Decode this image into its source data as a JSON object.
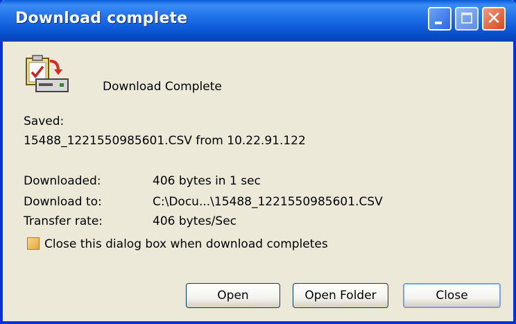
{
  "window": {
    "title": "Download complete"
  },
  "titlebar_buttons": {
    "minimize": "minimize-icon",
    "maximize": "maximize-icon",
    "close": "close-icon",
    "close_glyph": "✕"
  },
  "header": {
    "icon": "download-complete-icon",
    "message": "Download Complete"
  },
  "saved": {
    "label": "Saved:",
    "value": "15488_1221550985601.CSV from 10.22.91.122"
  },
  "details": [
    {
      "label": "Downloaded:",
      "value": "406 bytes in 1 sec"
    },
    {
      "label": "Download to:",
      "value": "C:\\Docu...\\15488_1221550985601.CSV"
    },
    {
      "label": "Transfer rate:",
      "value": "406 bytes/Sec"
    }
  ],
  "close_on_complete": {
    "label": "Close this dialog box when download completes",
    "checked": false
  },
  "buttons": {
    "open": "Open",
    "open_folder": "Open Folder",
    "close": "Close"
  }
}
